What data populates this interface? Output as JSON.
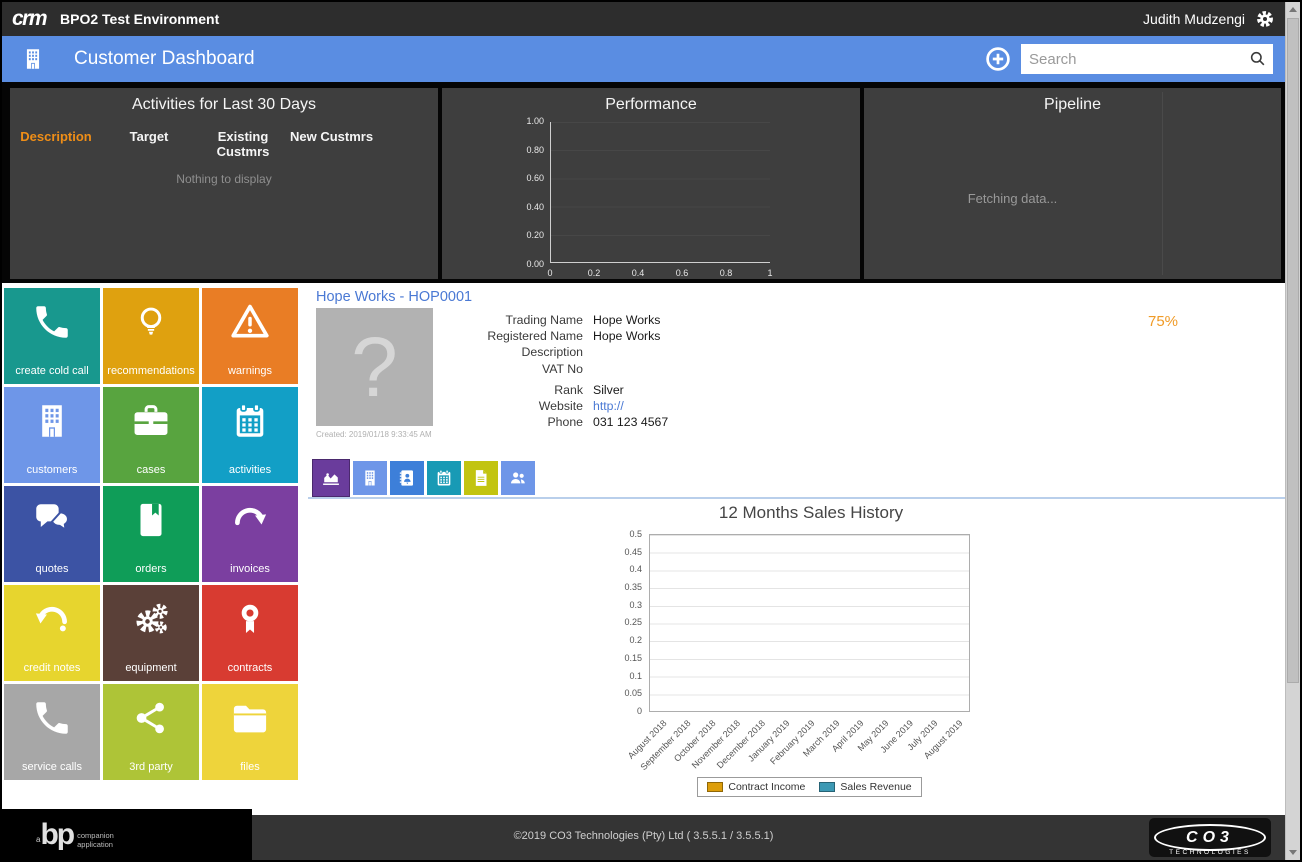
{
  "header": {
    "logo_text": "crm",
    "app_title": "BPO2 Test Environment",
    "user_name": "Judith Mudzengi"
  },
  "toolbar": {
    "page_title": "Customer Dashboard",
    "search_placeholder": "Search"
  },
  "panels": {
    "activities": {
      "title": "Activities for Last 30 Days",
      "columns": [
        "Description",
        "Target",
        "Existing Custmrs",
        "New Custmrs"
      ],
      "empty_text": "Nothing to display"
    },
    "performance": {
      "title": "Performance"
    },
    "pipeline": {
      "title": "Pipeline",
      "loading_text": "Fetching data..."
    }
  },
  "chart_data": {
    "performance": {
      "type": "bar",
      "title": "Performance",
      "x_ticks": [
        "0",
        "0.2",
        "0.4",
        "0.6",
        "0.8",
        "1"
      ],
      "y_ticks": [
        "1.00",
        "0.80",
        "0.60",
        "0.40",
        "0.20",
        "0.00"
      ],
      "xlim": [
        0,
        1
      ],
      "ylim": [
        0,
        1
      ],
      "series": [],
      "note": "empty chart - no data plotted"
    },
    "sales_history": {
      "type": "bar",
      "title": "12 Months Sales History",
      "categories": [
        "August 2018",
        "September 2018",
        "October 2018",
        "November 2018",
        "December 2018",
        "January 2019",
        "February 2019",
        "March 2019",
        "April 2019",
        "May 2019",
        "June 2019",
        "July 2019",
        "August 2019"
      ],
      "y_ticks": [
        "0.5",
        "0.45",
        "0.4",
        "0.35",
        "0.3",
        "0.25",
        "0.2",
        "0.15",
        "0.1",
        "0.05",
        "0"
      ],
      "ylim": [
        0,
        0.5
      ],
      "grid": true,
      "legend_position": "bottom",
      "series": [
        {
          "name": "Contract Income",
          "color": "#dd9e0b",
          "values": []
        },
        {
          "name": "Sales Revenue",
          "color": "#3d99b4",
          "values": []
        }
      ],
      "note": "empty chart - no data plotted"
    }
  },
  "tiles": [
    {
      "name": "tile-create-cold-call",
      "label": "create cold call",
      "color": "#18988e",
      "icon": "phone"
    },
    {
      "name": "tile-recommendations",
      "label": "recommendations",
      "color": "#dfa10f",
      "icon": "bulb"
    },
    {
      "name": "tile-warnings",
      "label": "warnings",
      "color": "#e97d25",
      "icon": "warning"
    },
    {
      "name": "tile-customers",
      "label": "customers",
      "color": "#6e96e8",
      "icon": "building"
    },
    {
      "name": "tile-cases",
      "label": "cases",
      "color": "#58a43f",
      "icon": "briefcase"
    },
    {
      "name": "tile-activities",
      "label": "activities",
      "color": "#129fc6",
      "icon": "calendar"
    },
    {
      "name": "tile-quotes",
      "label": "quotes",
      "color": "#3c53a4",
      "icon": "chat"
    },
    {
      "name": "tile-orders",
      "label": "orders",
      "color": "#0f9d58",
      "icon": "book"
    },
    {
      "name": "tile-invoices",
      "label": "invoices",
      "color": "#7b3fa0",
      "icon": "redo"
    },
    {
      "name": "tile-credit-notes",
      "label": "credit notes",
      "color": "#e7d52e",
      "icon": "undo"
    },
    {
      "name": "tile-equipment",
      "label": "equipment",
      "color": "#5a4038",
      "icon": "gears"
    },
    {
      "name": "tile-contracts",
      "label": "contracts",
      "color": "#d83b31",
      "icon": "award"
    },
    {
      "name": "tile-service-calls",
      "label": "service calls",
      "color": "#a7a7a7",
      "icon": "phone"
    },
    {
      "name": "tile-3rd-party",
      "label": "3rd party",
      "color": "#aec437",
      "icon": "share"
    },
    {
      "name": "tile-files",
      "label": "files",
      "color": "#eed43b",
      "icon": "folder"
    }
  ],
  "customer": {
    "link_text": "Hope Works - HOP0001",
    "photo_placeholder": "?",
    "created_text": "Created:  2019/01/18 9:33:45 AM",
    "fields_top": [
      {
        "label": "Trading Name",
        "value": "Hope Works"
      },
      {
        "label": "Registered Name",
        "value": "Hope Works"
      },
      {
        "label": "Description",
        "value": ""
      },
      {
        "label": "VAT No",
        "value": ""
      }
    ],
    "fields_bottom": [
      {
        "label": "Rank",
        "value": "Silver"
      },
      {
        "label": "Website",
        "value": "http://",
        "cls": "link"
      },
      {
        "label": "Phone",
        "value": "031 123 4567"
      }
    ],
    "progress": "75%"
  },
  "tabs": [
    {
      "name": "tab-sales-chart",
      "color": "#6a3c9c",
      "icon": "chart-area",
      "state": "active"
    },
    {
      "name": "tab-customer-info",
      "color": "#6e96e8",
      "icon": "building",
      "state": ""
    },
    {
      "name": "tab-contacts",
      "color": "#3d7fd9",
      "icon": "contact-book",
      "state": ""
    },
    {
      "name": "tab-activities",
      "color": "#189ab5",
      "icon": "calendar",
      "state": ""
    },
    {
      "name": "tab-documents",
      "color": "#c2c410",
      "icon": "document",
      "state": ""
    },
    {
      "name": "tab-people",
      "color": "#6e96e8",
      "icon": "people",
      "state": ""
    }
  ],
  "sales_section": {
    "title": "12 Months Sales History"
  },
  "footer": {
    "copyright": "©2019 CO3 Technologies (Pty) Ltd ( 3.5.5.1 / 3.5.5.1)",
    "bp_prefix": "a",
    "bp_logo": "bp",
    "bp_line1": "companion",
    "bp_line2": "application",
    "co3_logo": "CO3",
    "co3_sub": "TECHNOLOGIES"
  }
}
